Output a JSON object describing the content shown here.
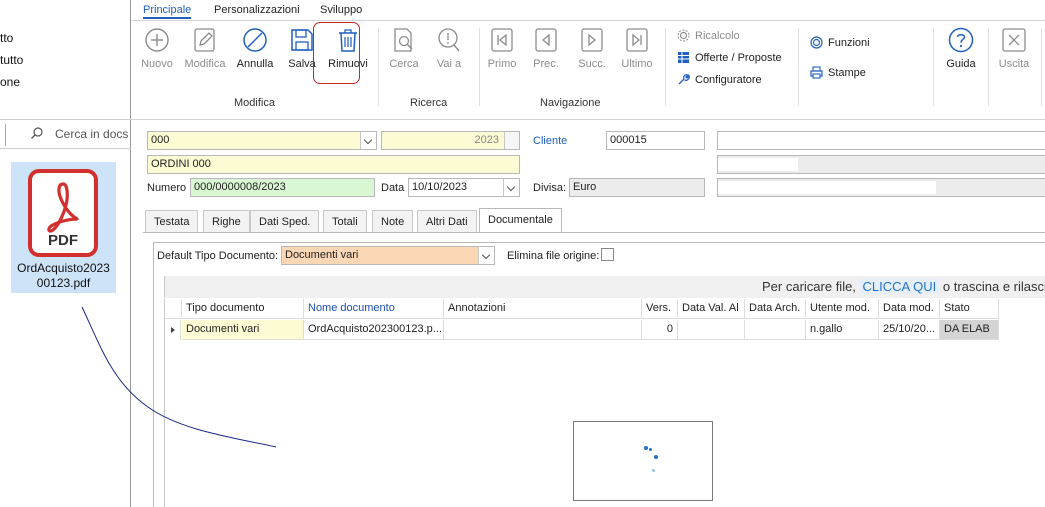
{
  "explorer": {
    "items": [
      "tto",
      "tutto",
      "one"
    ],
    "search_placeholder": "Cerca in docs",
    "file_name": "OrdAcquisto202300123.pdf",
    "file_name_line1": "OrdAcquisto2023",
    "file_name_line2": "00123.pdf",
    "pdf_label": "PDF"
  },
  "ribbon": {
    "tabs": [
      "Principale",
      "Personalizzazioni",
      "Sviluppo"
    ],
    "active_tab": "Principale",
    "buttons": {
      "nuovo": "Nuovo",
      "modifica": "Modifica",
      "annulla": "Annulla",
      "salva": "Salva",
      "rimuovi": "Rimuovi",
      "cerca": "Cerca",
      "vai_a": "Vai a",
      "primo": "Primo",
      "prec": "Prec.",
      "succ": "Succ.",
      "ultimo": "Ultimo",
      "guida": "Guida",
      "uscita": "Uscita"
    },
    "side_items": {
      "ricalcolo": "Ricalcolo",
      "offerte": "Offerte / Proposte",
      "configuratore": "Configuratore",
      "funzioni": "Funzioni",
      "stampe": "Stampe"
    },
    "groups": {
      "modifica": "Modifica",
      "ricerca": "Ricerca",
      "navigazione": "Navigazione"
    }
  },
  "form": {
    "serie": "000",
    "anno": "2023",
    "descrizione": "ORDINI 000",
    "numero_label": "Numero",
    "numero": "000/0000008/2023",
    "data_label": "Data",
    "data": "10/10/2023",
    "cliente_label": "Cliente",
    "cliente_code": "000015",
    "divisa_label": "Divisa:",
    "divisa": "Euro"
  },
  "form_tabs": [
    "Testata",
    "Righe",
    "Dati Sped.",
    "Totali",
    "Note",
    "Altri Dati",
    "Documentale"
  ],
  "active_form_tab": "Documentale",
  "documentale": {
    "default_tipo_label": "Default Tipo Documento:",
    "default_tipo_value": "Documenti vari",
    "elimina_label": "Elimina file origine:",
    "upload_prefix": "Per caricare file,",
    "upload_link": "CLICCA QUI",
    "upload_suffix": "o trascina e rilasci",
    "columns": [
      "Tipo documento",
      "Nome documento",
      "Annotazioni",
      "Vers.",
      "Data Val. Al",
      "Data Arch.",
      "Utente mod.",
      "Data mod.",
      "Stato"
    ],
    "rows": [
      {
        "tipo": "Documenti vari",
        "nome": "OrdAcquisto202300123.p...",
        "annotazioni": "",
        "vers": "0",
        "data_val": "",
        "data_arch": "",
        "utente": "n.gallo",
        "data_mod": "25/10/20...",
        "stato": "DA ELAB"
      }
    ]
  },
  "colors": {
    "accent": "#1f5fbf",
    "yellow_field": "#fdfbd3",
    "green_field": "#d9f7d2",
    "orange_field": "#fbd7b6",
    "pdf_red": "#d32f2f",
    "highlight_red": "#c62828"
  }
}
